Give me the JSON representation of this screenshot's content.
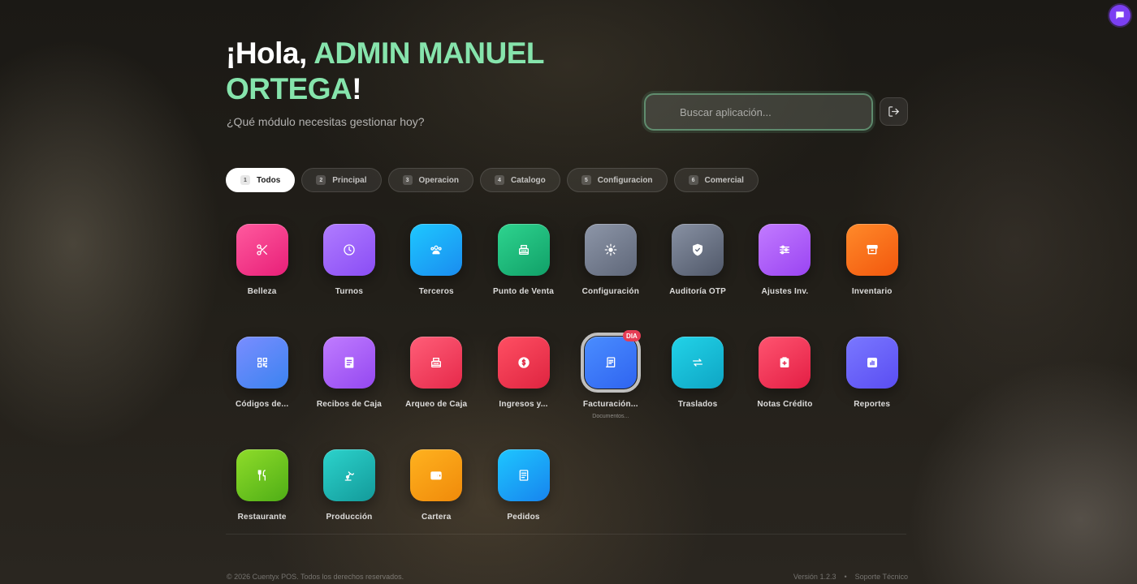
{
  "header": {
    "greeting_prefix": "¡Hola, ",
    "user_name": "ADMIN MANUEL ORTEGA",
    "greeting_suffix": "!",
    "subtitle": "¿Qué módulo necesitas gestionar hoy?"
  },
  "search": {
    "placeholder": "Buscar aplicación...",
    "value": ""
  },
  "tabs": [
    {
      "num": "1",
      "label": "Todos",
      "active": true
    },
    {
      "num": "2",
      "label": "Principal"
    },
    {
      "num": "3",
      "label": "Operacion"
    },
    {
      "num": "4",
      "label": "Catalogo"
    },
    {
      "num": "5",
      "label": "Configuracion"
    },
    {
      "num": "6",
      "label": "Comercial"
    }
  ],
  "apps": [
    {
      "label": "Belleza",
      "icon": "scissors-icon",
      "colors": [
        "#ff5a9e",
        "#e81f78"
      ]
    },
    {
      "label": "Turnos",
      "icon": "clock-icon",
      "colors": [
        "#b07cff",
        "#8a4df5"
      ]
    },
    {
      "label": "Terceros",
      "icon": "users-icon",
      "colors": [
        "#1ec8ff",
        "#1a8cf0"
      ]
    },
    {
      "label": "Punto de Venta",
      "icon": "cash-register-icon",
      "colors": [
        "#2ed48f",
        "#11a068"
      ]
    },
    {
      "label": "Configuración",
      "icon": "gear-icon",
      "colors": [
        "#8d96a8",
        "#5f6779"
      ]
    },
    {
      "label": "Auditoría OTP",
      "icon": "shield-check-icon",
      "colors": [
        "#8891a3",
        "#505869"
      ]
    },
    {
      "label": "Ajustes Inv.",
      "icon": "sliders-icon",
      "colors": [
        "#c27bff",
        "#9a44f2"
      ]
    },
    {
      "label": "Inventario",
      "icon": "archive-box-icon",
      "colors": [
        "#ff8a2a",
        "#f2570d"
      ]
    },
    {
      "label": "Códigos de...",
      "icon": "qr-code-icon",
      "colors": [
        "#7a8dff",
        "#3b83f0"
      ]
    },
    {
      "label": "Recibos de Caja",
      "icon": "receipt-icon",
      "colors": [
        "#c07cff",
        "#9448f0"
      ]
    },
    {
      "label": "Arqueo de Caja",
      "icon": "cash-register-icon",
      "colors": [
        "#ff5e78",
        "#e6294a"
      ]
    },
    {
      "label": "Ingresos y...",
      "icon": "dollar-coin-icon",
      "colors": [
        "#ff4f63",
        "#de2440"
      ]
    },
    {
      "label": "Facturación...",
      "sublabel": "Documentos...",
      "badge": "DIA",
      "selected": true,
      "icon": "invoice-icon",
      "colors": [
        "#4a8dff",
        "#2f64f0"
      ]
    },
    {
      "label": "Traslados",
      "icon": "transfer-arrows-icon",
      "colors": [
        "#22d3e8",
        "#0ea5c4"
      ]
    },
    {
      "label": "Notas Crédito",
      "icon": "medical-note-icon",
      "colors": [
        "#ff5470",
        "#e31e44"
      ]
    },
    {
      "label": "Reportes",
      "icon": "bar-chart-icon",
      "colors": [
        "#7a78ff",
        "#5a4df2"
      ]
    },
    {
      "label": "Restaurante",
      "icon": "fork-knife-icon",
      "colors": [
        "#8fdc2a",
        "#4fae16"
      ]
    },
    {
      "label": "Producción",
      "icon": "robot-arm-icon",
      "colors": [
        "#2cd3cc",
        "#139a9a"
      ]
    },
    {
      "label": "Cartera",
      "icon": "wallet-icon",
      "colors": [
        "#ffb21f",
        "#f08a0a"
      ]
    },
    {
      "label": "Pedidos",
      "icon": "order-list-icon",
      "colors": [
        "#1ec6ff",
        "#1784ee"
      ]
    }
  ],
  "footer": {
    "copyright": "© 2026 Cuentyx POS. Todos los derechos reservados.",
    "version": "Versión 1.2.3",
    "separator": "•",
    "support": "Soporte Técnico"
  }
}
